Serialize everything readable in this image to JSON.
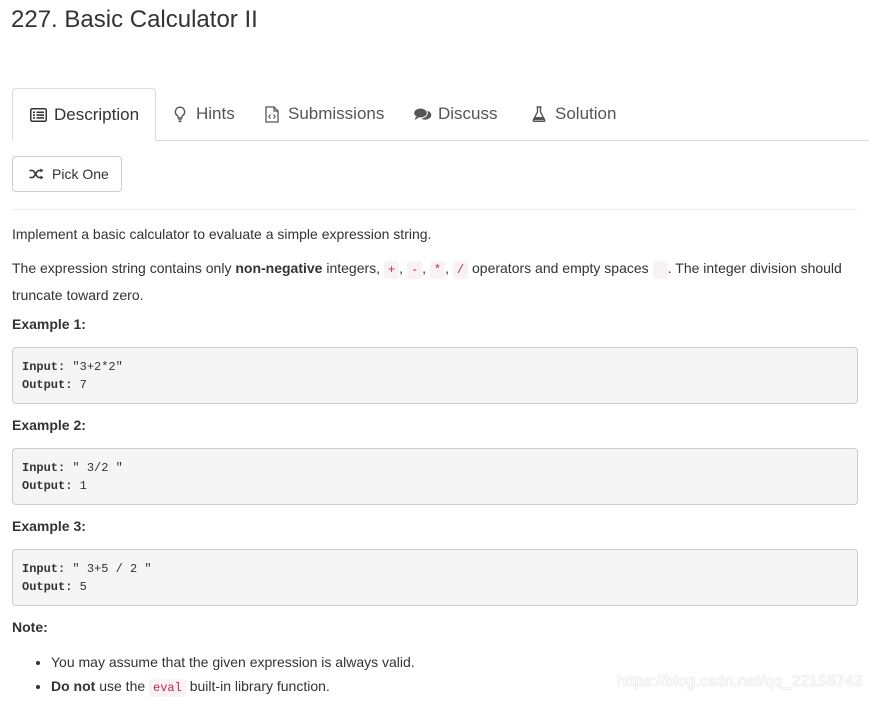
{
  "problem": {
    "title": "227. Basic Calculator II"
  },
  "tabs": [
    {
      "label": "Description",
      "icon": "list-icon"
    },
    {
      "label": "Hints",
      "icon": "lightbulb-icon"
    },
    {
      "label": "Submissions",
      "icon": "file-code-icon"
    },
    {
      "label": "Discuss",
      "icon": "comments-icon"
    },
    {
      "label": "Solution",
      "icon": "flask-icon"
    }
  ],
  "pick_one": {
    "label": "Pick One",
    "icon": "shuffle-icon"
  },
  "description": {
    "line1": "Implement a basic calculator to evaluate a simple expression string.",
    "line2_pre": "The expression string contains only ",
    "line2_bold": "non-negative",
    "line2_mid": " integers, ",
    "ops": [
      "+",
      "-",
      "*",
      "/"
    ],
    "sep": ", ",
    "line2_post": " operators and empty spaces ",
    "space_code": " ",
    "line2_end": ". The integer division should truncate toward zero."
  },
  "examples": [
    {
      "heading": "Example 1:",
      "input_label": "Input:",
      "input_value": " \"3+2*2\"",
      "output_label": "Output:",
      "output_value": " 7"
    },
    {
      "heading": "Example 2:",
      "input_label": "Input:",
      "input_value": " \" 3/2 \"",
      "output_label": "Output:",
      "output_value": " 1"
    },
    {
      "heading": "Example 3:",
      "input_label": "Input:",
      "input_value": " \" 3+5 / 2 \"",
      "output_label": "Output:",
      "output_value": " 5"
    }
  ],
  "note": {
    "heading": "Note:",
    "item1": "You may assume that the given expression is always valid.",
    "item2_bold": "Do not",
    "item2_pre": " use the ",
    "item2_code": "eval",
    "item2_post": " built-in library function."
  },
  "watermark": "https://blog.csdn.net/qq_22158743"
}
